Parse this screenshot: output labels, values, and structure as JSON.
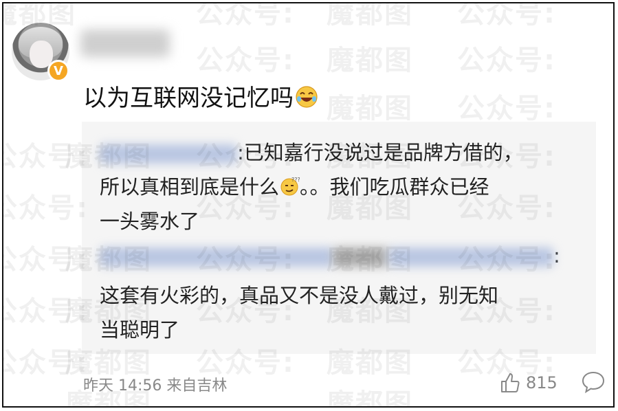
{
  "post": {
    "text": "以为互联网没记忆吗",
    "emoji": "laughing-tears-icon"
  },
  "quote": {
    "line1_text": ":已知嘉行没说过是品牌方借的，",
    "line2_text": "所以真相到底是什么",
    "line2_suffix": "。。我们吃瓜群众已经",
    "line3_text": "一头雾水了",
    "line4_text": ":",
    "line5_text": "这套有火彩的，真品又不是没人戴过，别无知",
    "line6_text": "当聪明了"
  },
  "footer": {
    "time": "昨天 14:56 来自吉林",
    "like_count": "815"
  },
  "watermark": {
    "text_a": "公众号:",
    "text_b": "魔都图"
  },
  "colors": {
    "badge": "#f5a623",
    "quote_bg": "#f5f5f5",
    "meta_text": "#888888"
  }
}
